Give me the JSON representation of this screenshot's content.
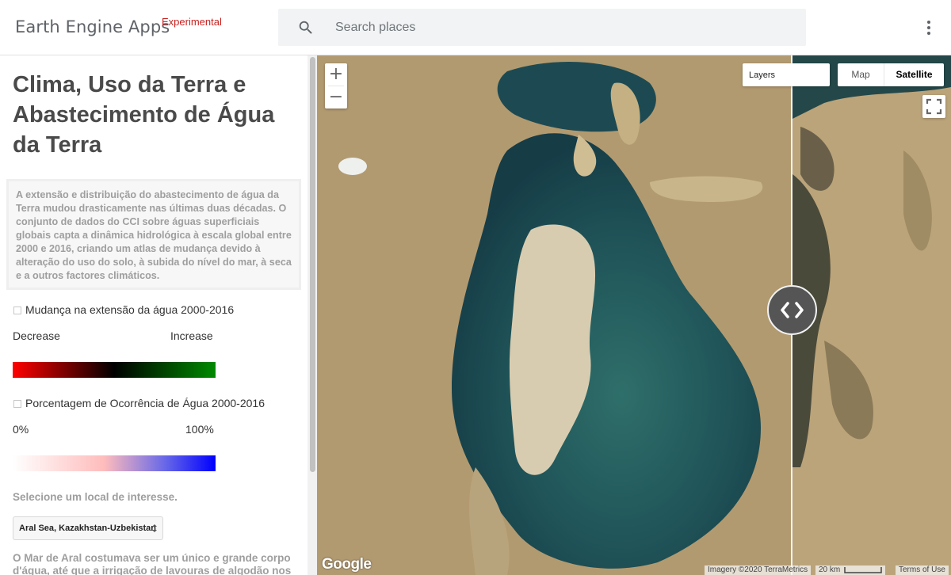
{
  "header": {
    "brand": "Earth Engine Apps",
    "brand_tag": "Experimental",
    "search_placeholder": "Search places"
  },
  "panel": {
    "title": "Clima, Uso da Terra e Abastecimento de Água da Terra",
    "description": "A extensão e distribuição do abastecimento de água da Terra mudou drasticamente nas últimas duas décadas. O conjunto de dados do CCI sobre águas superficiais globais capta a dinâmica hidrológica à escala global entre 2000 e 2016, criando um atlas de mudança devido à alteração do uso do solo, à subida do nível do mar, à seca e a outros factores climáticos.",
    "layer1": {
      "label": "Mudança na extensão da água 2000-2016",
      "checked": false,
      "legend_min": "Decrease",
      "legend_max": "Increase",
      "colors": [
        "#ff0000",
        "#000000",
        "#008a00"
      ]
    },
    "layer2": {
      "label": "Porcentagem de Ocorrência de Água 2000-2016",
      "checked": false,
      "legend_min": "0%",
      "legend_max": "100%",
      "colors": [
        "#ffffff",
        "#ffbcbc",
        "#0000ff"
      ]
    },
    "select_prompt": "Selecione um local de interesse.",
    "location_selected": "Aral Sea, Kazakhstan-Uzbekistan",
    "body": "O Mar de Aral costumava ser um único e grande corpo d'água, até que a irrigação de lavouras de algodão nos"
  },
  "map": {
    "zoom_in": "+",
    "zoom_out": "−",
    "layers_label": "Layers",
    "maptype_map": "Map",
    "maptype_satellite": "Satellite",
    "maptype_selected": "Satellite",
    "google_logo": "Google",
    "imagery": "Imagery ©2020 TerraMetrics",
    "scale": "20 km",
    "terms": "Terms of Use"
  },
  "colors": {
    "accent_red": "#c5221f",
    "water_dark": "#163c46",
    "water_teal": "#2f6f6a",
    "land": "#b29a70"
  }
}
